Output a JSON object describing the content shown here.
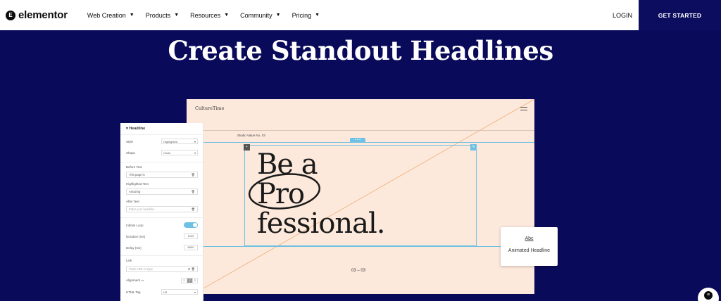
{
  "nav": {
    "logo_mark": "E",
    "logo_text": "elementor",
    "menu": [
      {
        "label": "Web Creation"
      },
      {
        "label": "Products"
      },
      {
        "label": "Resources"
      },
      {
        "label": "Community"
      },
      {
        "label": "Pricing"
      }
    ],
    "login": "LOGIN",
    "cta": "GET STARTED"
  },
  "hero": {
    "title": "Create Standout Headlines"
  },
  "canvas": {
    "brand": "CultureTime",
    "studio": "Studio Value No. 03",
    "headline_1": "Be a",
    "headline_2": "Pro",
    "headline_3": "fessional.",
    "pager": "03 – 03",
    "accent_color": "#6ec1e4",
    "bg_color": "#fde9dc"
  },
  "panel": {
    "title": "Headline",
    "style_label": "Style",
    "style_value": "Highlighted",
    "shape_label": "Shape",
    "shape_value": "Circle",
    "before_label": "Before Text",
    "before_value": "This page is",
    "highlighted_label": "Highlighted Text",
    "highlighted_value": "Amazing",
    "after_label": "After Text",
    "after_placeholder": "Enter your headline",
    "loop_label": "Infinite Loop",
    "duration_label": "Duration (ms)",
    "duration_value": "1200",
    "delay_label": "Delay (ms)",
    "delay_value": "8000",
    "link_label": "Link",
    "link_placeholder": "Paste URL or type",
    "alignment_label": "Alignment",
    "tag_label": "HTML Tag",
    "tag_value": "H3"
  },
  "widget": {
    "icon": "Abc",
    "label": "Animated Headline"
  },
  "colors": {
    "page_bg": "#0a0a5a",
    "cta_bg": "#0c0d5e"
  }
}
